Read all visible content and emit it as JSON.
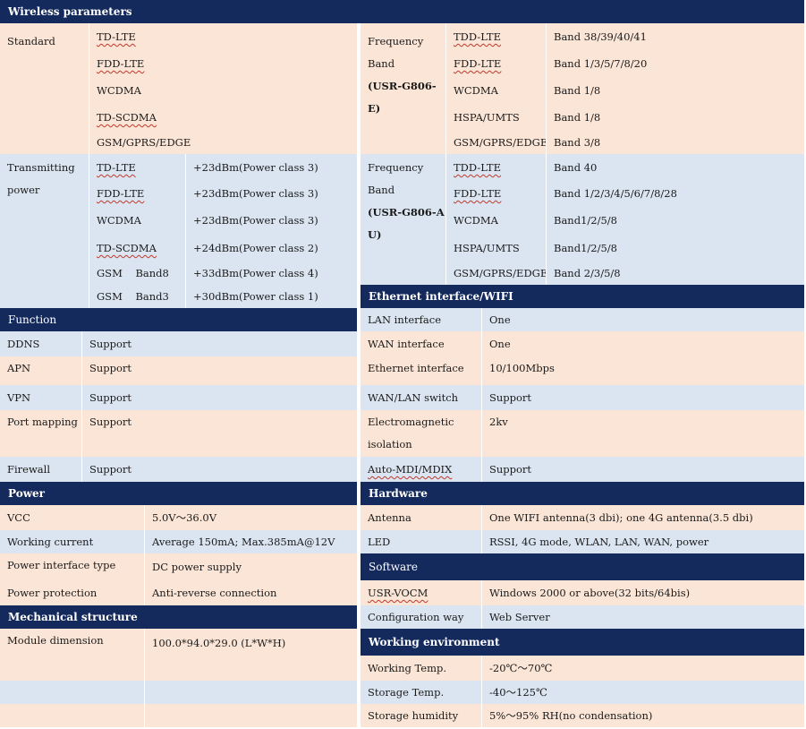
{
  "wireless": {
    "title": "Wireless parameters",
    "standard_label": "Standard",
    "standards": [
      "TD-LTE",
      "FDD-LTE",
      "WCDMA",
      "TD-SCDMA",
      "GSM/GPRS/EDGE"
    ],
    "tx_label_1": "Transmitting",
    "tx_label_2": "power",
    "tx_rows": [
      {
        "name": "TD-LTE",
        "value": "+23dBm(Power class 3)"
      },
      {
        "name": "FDD-LTE",
        "value": "+23dBm(Power class 3)"
      },
      {
        "name": "WCDMA",
        "value": "+23dBm(Power class 3)"
      },
      {
        "name": "TD-SCDMA",
        "value": "+24dBm(Power class 2)"
      },
      {
        "name": "GSM    Band8",
        "value": "+33dBm(Power class 4)"
      },
      {
        "name": "GSM    Band3",
        "value": "+30dBm(Power class 1)"
      }
    ],
    "freq_e_label_1": "Frequency",
    "freq_e_label_2": "Band",
    "freq_e_label_3": "(USR-G806-E)",
    "freq_e_rows": [
      {
        "name": "TDD-LTE",
        "value": "Band 38/39/40/41"
      },
      {
        "name": "FDD-LTE",
        "value": "Band 1/3/5/7/8/20"
      },
      {
        "name": "WCDMA",
        "value": "Band 1/8"
      },
      {
        "name": "HSPA/UMTS",
        "value": "Band 1/8"
      },
      {
        "name": "GSM/GPRS/EDGE",
        "value": "Band 3/8"
      }
    ],
    "freq_au_label_1": "Frequency",
    "freq_au_label_2": "Band",
    "freq_au_label_3": "(USR-G806-A",
    "freq_au_label_4": "U)",
    "freq_au_rows": [
      {
        "name": "TDD-LTE",
        "value": "Band 40"
      },
      {
        "name": "FDD-LTE",
        "value": "Band 1/2/3/4/5/6/7/8/28"
      },
      {
        "name": "WCDMA",
        "value": "Band1/2/5/8"
      },
      {
        "name": "HSPA/UMTS",
        "value": "Band1/2/5/8"
      },
      {
        "name": "GSM/GPRS/EDGE",
        "value": "Band 2/3/5/8"
      }
    ]
  },
  "function": {
    "title": "Function",
    "rows": [
      {
        "name": "DDNS",
        "value": "Support"
      },
      {
        "name": "APN",
        "value": "Support"
      },
      {
        "name": "VPN",
        "value": "Support"
      },
      {
        "name": "Port mapping",
        "value": "Support"
      },
      {
        "name": "Firewall",
        "value": "Support"
      }
    ]
  },
  "ethernet": {
    "title": "Ethernet interface/WIFI",
    "rows": [
      {
        "name": "LAN interface",
        "value": "One"
      },
      {
        "name": "WAN interface",
        "value": "One"
      },
      {
        "name": "Ethernet interface rate",
        "value": "10/100Mbps"
      },
      {
        "name": "WAN/LAN switch",
        "value": "Support"
      },
      {
        "name": "Electromagnetic",
        "name2": "isolation",
        "value": "2kv"
      },
      {
        "name": "Auto-MDI/MDIX",
        "value": "Support"
      }
    ]
  },
  "power": {
    "title": "Power",
    "rows": [
      {
        "name": "VCC",
        "value": "5.0V～36.0V"
      },
      {
        "name": "Working current",
        "value": "Average 150mA; Max.385mA@12V"
      },
      {
        "name": "Power interface type",
        "value": "DC power supply"
      },
      {
        "name": "Power protection",
        "value": "Anti-reverse connection"
      }
    ]
  },
  "hardware": {
    "title": "Hardware",
    "rows": [
      {
        "name": "Antenna",
        "value": "One WIFI antenna(3 dbi); one 4G antenna(3.5 dbi)"
      },
      {
        "name": "LED",
        "value": "RSSI, 4G mode, WLAN, LAN, WAN, power"
      }
    ]
  },
  "mechanical": {
    "title": "Mechanical structure",
    "rows": [
      {
        "name": "Module dimension",
        "value": "100.0*94.0*29.0 (L*W*H)"
      }
    ]
  },
  "software": {
    "title": "Software",
    "rows": [
      {
        "name": "USR-VOCM",
        "value": "Windows 2000 or above(32 bits/64bis)"
      },
      {
        "name": "Configuration way",
        "value": "Web Server"
      }
    ]
  },
  "environment": {
    "title": "Working environment",
    "rows": [
      {
        "name": "Working Temp.",
        "value": "-20℃～70℃"
      },
      {
        "name": "Storage Temp.",
        "value": "-40～125℃"
      },
      {
        "name": "Storage humidity",
        "value": "5%～95% RH(no condensation)"
      }
    ]
  },
  "colors": {
    "header": "#142a5c",
    "peach": "#fbe5d6",
    "blue": "#dbe5f1"
  }
}
